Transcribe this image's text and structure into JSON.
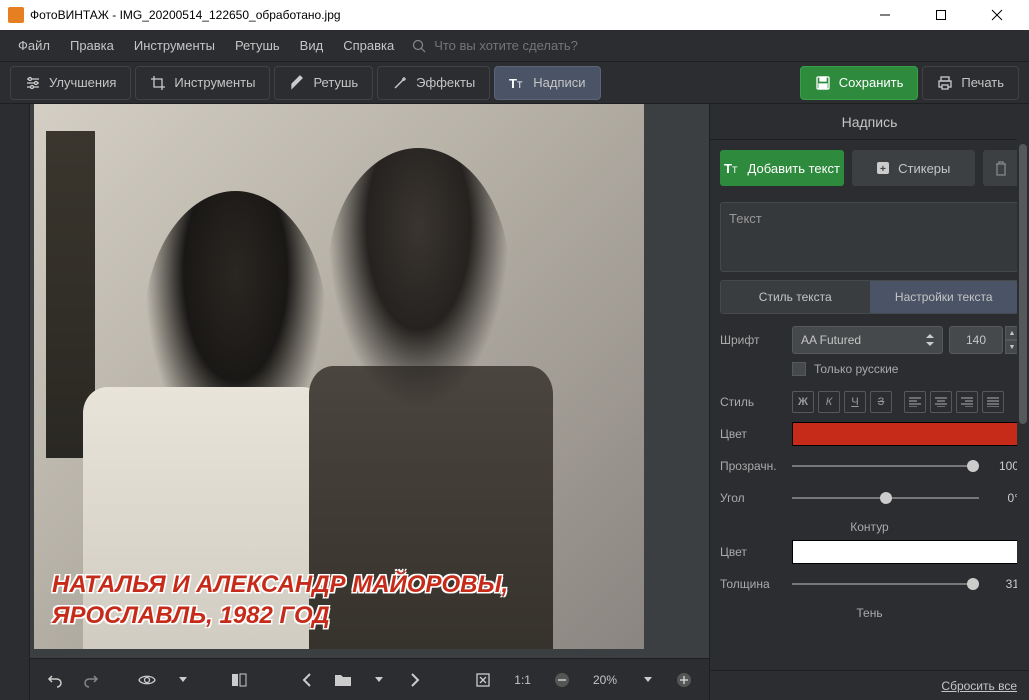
{
  "window": {
    "app_name": "ФотоВИНТАЖ",
    "file_name": "IMG_20200514_122650_обработано.jpg"
  },
  "menu": {
    "items": [
      "Файл",
      "Правка",
      "Инструменты",
      "Ретушь",
      "Вид",
      "Справка"
    ],
    "search_placeholder": "Что вы хотите сделать?"
  },
  "toolbar": {
    "tabs": [
      {
        "label": "Улучшения",
        "icon": "sliders"
      },
      {
        "label": "Инструменты",
        "icon": "crop"
      },
      {
        "label": "Ретушь",
        "icon": "brush"
      },
      {
        "label": "Эффекты",
        "icon": "wand"
      },
      {
        "label": "Надписи",
        "icon": "text",
        "active": true
      }
    ],
    "active_index": 4,
    "save_label": "Сохранить",
    "print_label": "Печать"
  },
  "canvas": {
    "caption_line1": "НАТАЛЬЯ И АЛЕКСАНДР МАЙОРОВЫ,",
    "caption_line2": "Ярославль, 1982 год"
  },
  "bottom_bar": {
    "ratio": "1:1",
    "zoom": "20%"
  },
  "panel": {
    "title": "Надпись",
    "add_text": "Добавить текст",
    "stickers": "Стикеры",
    "text_placeholder": "Текст",
    "tab_style": "Стиль текста",
    "tab_settings": "Настройки текста",
    "font_label": "Шрифт",
    "font_value": "AA Futured",
    "font_size": "140",
    "russian_only": "Только русские",
    "style_label": "Стиль",
    "style_bold": "Ж",
    "style_italic": "К",
    "style_under": "Ч",
    "style_strike": "З",
    "color_label": "Цвет",
    "color_hex": "#c62b1a",
    "opacity_label": "Прозрачн.",
    "opacity_value": "100",
    "angle_label": "Угол",
    "angle_value": "0°",
    "outline_title": "Контур",
    "outline_color_label": "Цвет",
    "outline_color_hex": "#ffffff",
    "thickness_label": "Толщина",
    "thickness_value": "31",
    "shadow_title": "Тень",
    "reset": "Сбросить все"
  }
}
